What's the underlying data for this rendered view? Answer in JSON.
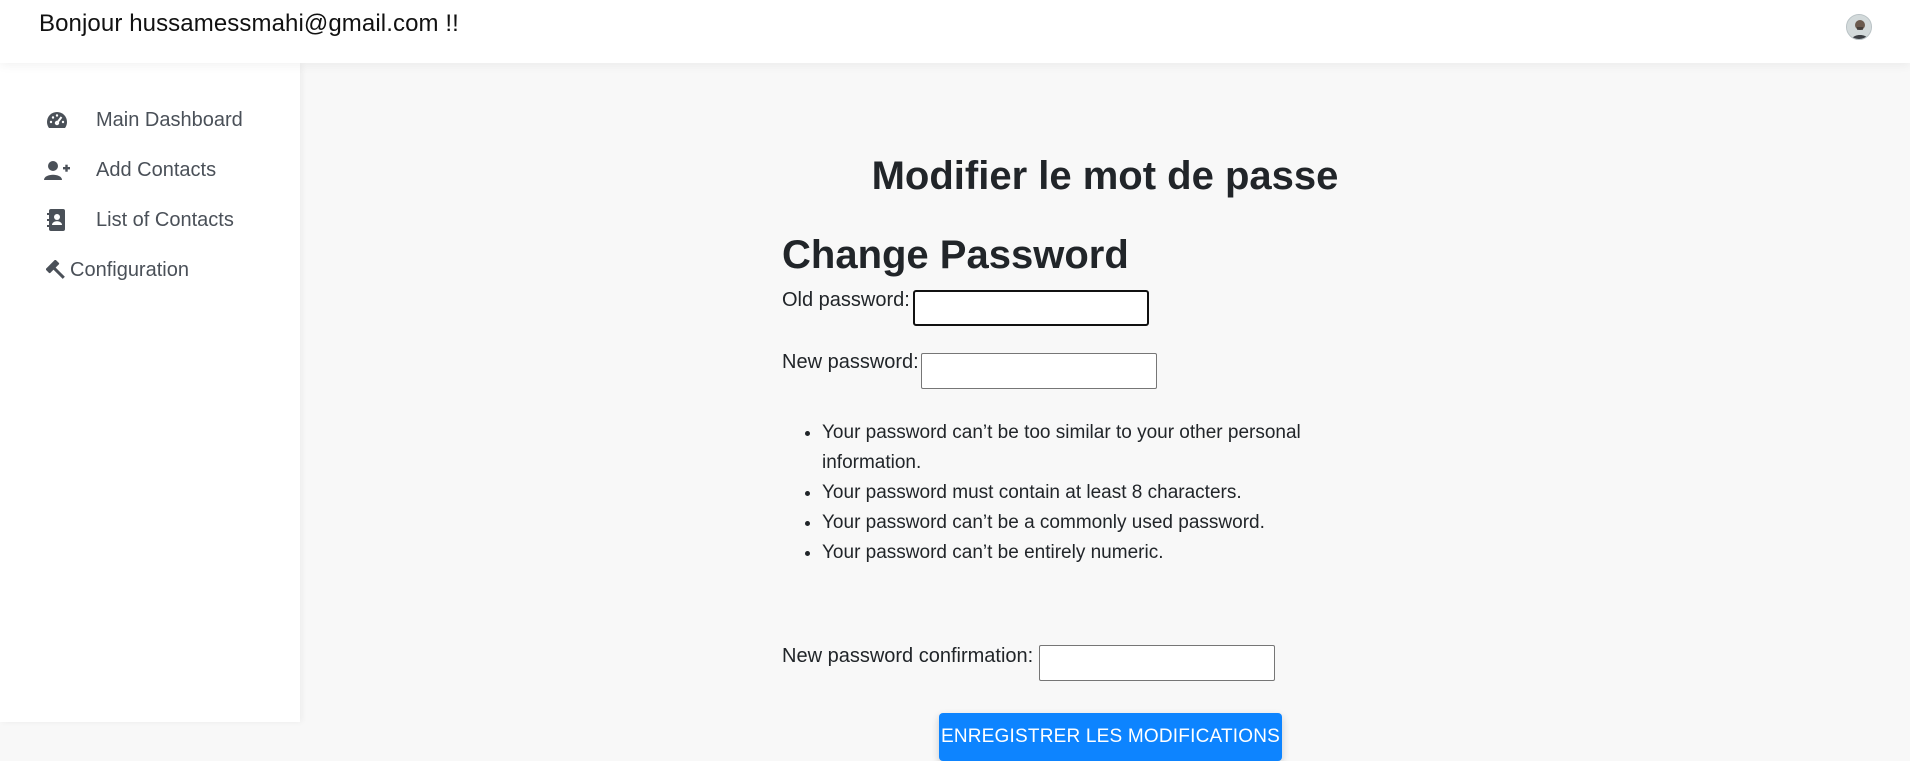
{
  "header": {
    "greeting": "Bonjour hussamessmahi@gmail.com !!",
    "avatar_icon": "user-avatar"
  },
  "sidebar": {
    "items": [
      {
        "label": "Main Dashboard",
        "icon": "tachometer-icon"
      },
      {
        "label": "Add Contacts",
        "icon": "user-plus-icon"
      },
      {
        "label": "List of Contacts",
        "icon": "address-book-icon"
      },
      {
        "label": "Configuration",
        "icon": "hammer-icon"
      }
    ]
  },
  "main": {
    "page_title": "Modifier le mot de passe",
    "form_title": "Change Password",
    "old_password_label": "Old password:",
    "old_password_value": "",
    "new_password_label": "New password:",
    "new_password_value": "",
    "rules": [
      "Your password can’t be too similar to your other personal information.",
      "Your password must contain at least 8 characters.",
      "Your password can’t be a commonly used password.",
      "Your password can’t be entirely numeric."
    ],
    "confirm_label": "New password confirmation:",
    "confirm_value": "",
    "save_button": "ENREGISTRER LES MODIFICATIONS"
  },
  "colors": {
    "primary_button": "#0d84ff",
    "sidebar_text": "#4a5058",
    "background": "#f8f8f8"
  }
}
